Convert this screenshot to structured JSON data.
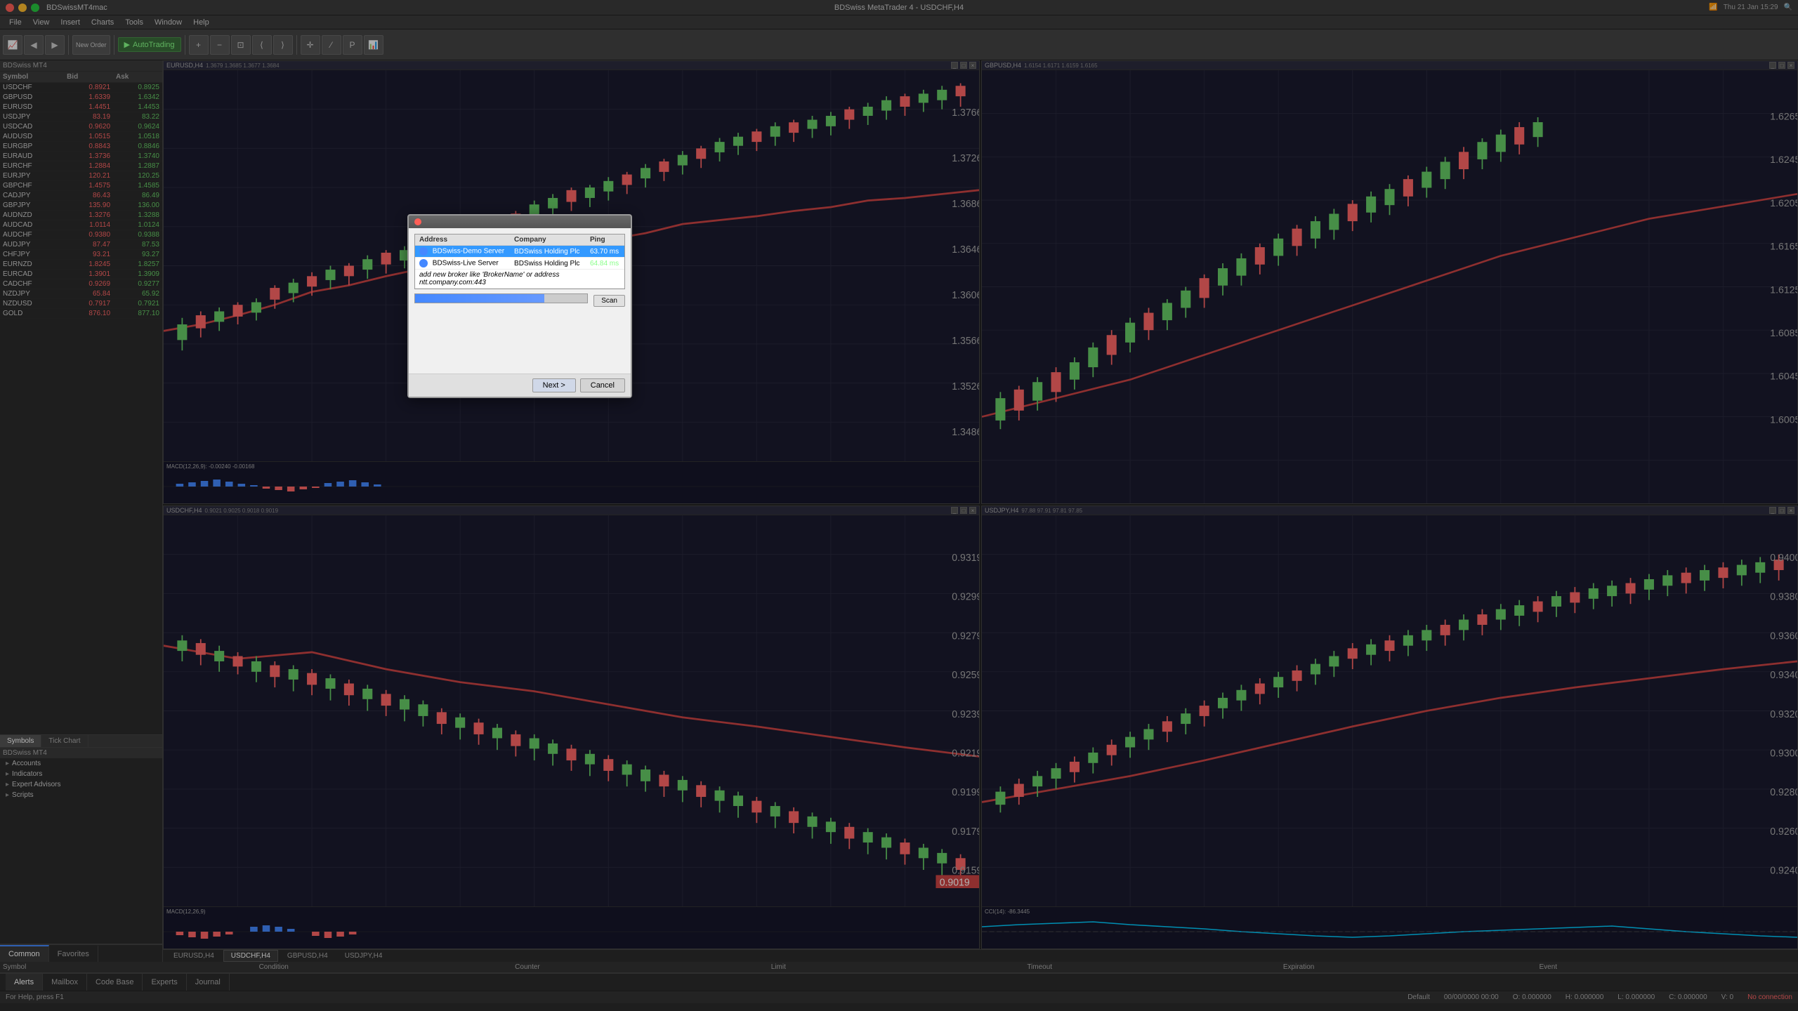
{
  "app": {
    "title": "BDSwiss MetaTrader 4 - USDCHF,H4",
    "app_name": "BDSwissMT4mac",
    "time": "Thu 21 Jan 15:29"
  },
  "menu": {
    "items": [
      "File",
      "View",
      "Insert",
      "Charts",
      "Tools",
      "Window",
      "Help"
    ]
  },
  "toolbar": {
    "autotrading_label": "AutoTrading"
  },
  "market_watch": {
    "header": "BDSwiss MT4",
    "columns": [
      "Symbol",
      "Bid",
      "Ask"
    ],
    "rows": [
      {
        "symbol": "USDCHF",
        "bid": "0.8921",
        "ask": "0.8925"
      },
      {
        "symbol": "GBPUSD",
        "bid": "1.6339",
        "ask": "1.6342"
      },
      {
        "symbol": "EURUSD",
        "bid": "1.4451",
        "ask": "1.4453"
      },
      {
        "symbol": "USDJPY",
        "bid": "83.19",
        "ask": "83.22"
      },
      {
        "symbol": "USDCAD",
        "bid": "0.9620",
        "ask": "0.9624"
      },
      {
        "symbol": "AUDUSD",
        "bid": "1.0515",
        "ask": "1.0518"
      },
      {
        "symbol": "EURGBP",
        "bid": "0.8843",
        "ask": "0.8846"
      },
      {
        "symbol": "EURAUD",
        "bid": "1.3736",
        "ask": "1.3740"
      },
      {
        "symbol": "EURCHF",
        "bid": "1.2884",
        "ask": "1.2887"
      },
      {
        "symbol": "EURJPY",
        "bid": "120.21",
        "ask": "120.25"
      },
      {
        "symbol": "GBPCHF",
        "bid": "1.4575",
        "ask": "1.4585"
      },
      {
        "symbol": "CADJPY",
        "bid": "86.43",
        "ask": "86.49"
      },
      {
        "symbol": "GBPJPY",
        "bid": "135.90",
        "ask": "136.00"
      },
      {
        "symbol": "AUDNZD",
        "bid": "1.3276",
        "ask": "1.3288"
      },
      {
        "symbol": "AUDCAD",
        "bid": "1.0114",
        "ask": "1.0124"
      },
      {
        "symbol": "AUDCHF",
        "bid": "0.9380",
        "ask": "0.9388"
      },
      {
        "symbol": "AUDJPY",
        "bid": "87.47",
        "ask": "87.53"
      },
      {
        "symbol": "CHFJPY",
        "bid": "93.21",
        "ask": "93.27"
      },
      {
        "symbol": "EURNZD",
        "bid": "1.8245",
        "ask": "1.8257"
      },
      {
        "symbol": "EURCAD",
        "bid": "1.3901",
        "ask": "1.3909"
      },
      {
        "symbol": "CADCHF",
        "bid": "0.9269",
        "ask": "0.9277"
      },
      {
        "symbol": "NZDJPY",
        "bid": "65.84",
        "ask": "65.92"
      },
      {
        "symbol": "NZDUSD",
        "bid": "0.7917",
        "ask": "0.7921"
      },
      {
        "symbol": "GOLD",
        "bid": "876.10",
        "ask": "877.10"
      }
    ],
    "tabs": [
      "Symbols",
      "Tick Chart"
    ]
  },
  "nav_tree": {
    "header": "BDSwiss MT4",
    "items": [
      {
        "label": "Accounts",
        "icon": "▸"
      },
      {
        "label": "Indicators",
        "icon": "▸"
      },
      {
        "label": "Expert Advisors",
        "icon": "▸"
      },
      {
        "label": "Scripts",
        "icon": "▸"
      }
    ]
  },
  "charts": [
    {
      "id": "eurusd",
      "title": "EURUSD,H4",
      "subtitle": "1.3679 1.3685 1.3677 1.3684",
      "indicator": "MACD(12,26,9)",
      "indicator_values": "-0.00240 -0.00168"
    },
    {
      "id": "gbpusd",
      "title": "GBPUSD,H4",
      "subtitle": "1.6154 1.6171 1.6159 1.6165"
    },
    {
      "id": "usdchf",
      "title": "USDCHF,H4",
      "subtitle": "0.9021 0.9025 0.9018 0.9019",
      "indicator": "MACD(12,26,9)",
      "indicator_values": ""
    },
    {
      "id": "usdjpy",
      "title": "USDJPY,H4",
      "subtitle": "97.88 97.91 97.81 97.85",
      "indicator": "CCI(14)",
      "indicator_values": "-86.3445"
    }
  ],
  "chart_tabs": [
    {
      "label": "EURUSD,H4",
      "active": false
    },
    {
      "label": "USDCHF,H4",
      "active": true
    },
    {
      "label": "GBPUSD,H4",
      "active": false
    },
    {
      "label": "USDJPY,H4",
      "active": false
    }
  ],
  "server_dialog": {
    "columns": [
      "Address",
      "Company",
      "Ping"
    ],
    "servers": [
      {
        "address": "BDSwiss-Demo Server",
        "company": "BDSwiss Holding Plc",
        "ping": "63.70 ms",
        "selected": true
      },
      {
        "address": "BDSwiss-Live Server",
        "company": "BDSwiss Holding Plc",
        "ping": "64.84 ms",
        "selected": false
      }
    ],
    "add_broker_text": "add new broker like 'BrokerName' or address ntt.company.com:443",
    "scan_button": "Scan",
    "next_button": "Next >",
    "cancel_button": "Cancel",
    "progress_pct": 75
  },
  "bottom_panel": {
    "tabs": [
      {
        "label": "Common",
        "active": true
      },
      {
        "label": "Favorites",
        "active": false
      }
    ]
  },
  "alert_columns": [
    "Symbol",
    "Condition",
    "Counter",
    "Limit",
    "Timeout",
    "Expiration",
    "Event"
  ],
  "alerts_bar": {
    "tabs": [
      "Alerts",
      "Mailbox",
      "Code Base",
      "Experts",
      "Journal"
    ]
  },
  "status_bar": {
    "help_text": "For Help, press F1",
    "default": "Default",
    "values": {
      "time": "00/00/0000 00:00",
      "o": "0.000000",
      "h": "0.000000",
      "l": "0.000000",
      "c": "0.000000",
      "v": "0",
      "connection": "No connection"
    }
  }
}
